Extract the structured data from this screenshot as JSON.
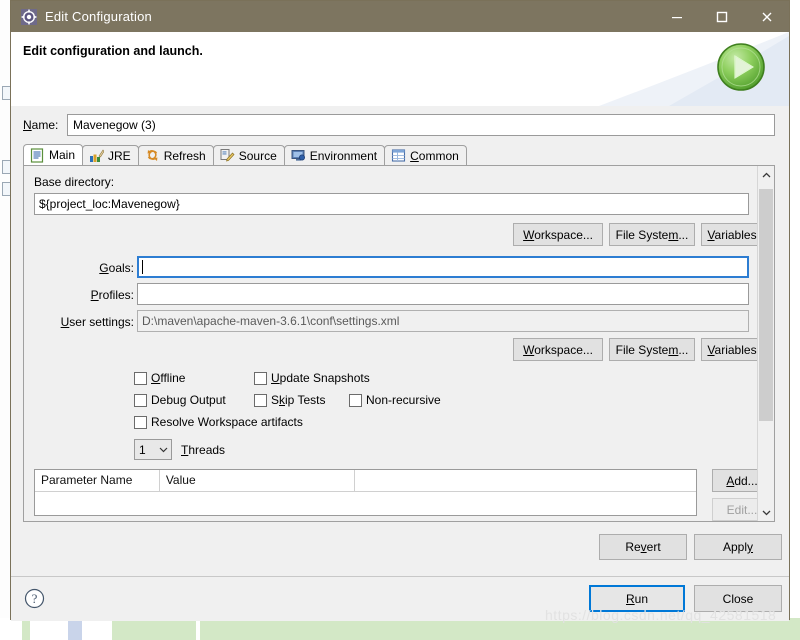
{
  "window": {
    "title": "Edit Configuration",
    "icon": "gear-icon",
    "minimize_label": "–",
    "maximize_label": "□",
    "close_label": "✕",
    "titlebar_color": "#7d7560"
  },
  "header": {
    "title": "Edit configuration and launch.",
    "run_icon": "green-run-ball-icon",
    "accent_green": "#5fb136"
  },
  "name_row": {
    "label": "Name:",
    "label_mnemonic": "N",
    "value": "Mavenegow (3)"
  },
  "tabs": [
    {
      "label": "Main",
      "mnemonic": "M",
      "icon": "main-document-icon",
      "active": true
    },
    {
      "label": "JRE",
      "mnemonic": "J",
      "icon": "jre-books-icon",
      "active": false
    },
    {
      "label": "Refresh",
      "mnemonic": "R",
      "icon": "refresh-arrows-icon",
      "active": false
    },
    {
      "label": "Source",
      "mnemonic": "S",
      "icon": "source-pencil-icon",
      "active": false
    },
    {
      "label": "Environment",
      "mnemonic": "E",
      "icon": "environment-monitor-icon",
      "active": false
    },
    {
      "label": "Common",
      "mnemonic": "C",
      "icon": "common-table-icon",
      "active": false
    }
  ],
  "main_tab": {
    "base_directory": {
      "label": "Base directory:",
      "value": "${project_loc:Mavenegow}",
      "placeholder": ""
    },
    "path_buttons_top": [
      {
        "label": "Workspace...",
        "mnemonic": "W"
      },
      {
        "label": "File System...",
        "mnemonic": "m"
      },
      {
        "label": "Variables...",
        "mnemonic": "V"
      }
    ],
    "goals": {
      "label": "Goals:",
      "mnemonic": "G",
      "value": "",
      "focused": true
    },
    "profiles": {
      "label": "Profiles:",
      "mnemonic": "P",
      "value": ""
    },
    "user_settings": {
      "label": "User settings:",
      "mnemonic": "U",
      "value": "D:\\maven\\apache-maven-3.6.1\\conf\\settings.xml",
      "readonly": true
    },
    "path_buttons_bottom": [
      {
        "label": "Workspace...",
        "mnemonic": "W"
      },
      {
        "label": "File System...",
        "mnemonic": "m"
      },
      {
        "label": "Variables...",
        "mnemonic": "V"
      }
    ],
    "checkboxes": [
      {
        "label": "Offline",
        "mnemonic": "O",
        "checked": false
      },
      {
        "label": "Update Snapshots",
        "mnemonic": "U",
        "checked": false
      },
      {
        "label": "Debug Output",
        "mnemonic": "g",
        "checked": false
      },
      {
        "label": "Skip Tests",
        "mnemonic": "k",
        "checked": false
      },
      {
        "label": "Non-recursive",
        "mnemonic": "",
        "checked": false
      },
      {
        "label": "Resolve Workspace artifacts",
        "mnemonic": "",
        "checked": false
      }
    ],
    "threads": {
      "value": "1",
      "label": "Threads",
      "mnemonic": "T",
      "options": [
        "1"
      ]
    },
    "parameter_table": {
      "columns": [
        "Parameter Name",
        "Value"
      ],
      "rows": []
    },
    "table_buttons": [
      {
        "label": "Add...",
        "mnemonic": "A"
      },
      {
        "label": "Edit...",
        "mnemonic": "E"
      }
    ],
    "scrollbar": {
      "up_arrow": "∧",
      "down_arrow": "∨"
    }
  },
  "action_buttons": {
    "revert": {
      "label": "Revert",
      "mnemonic": "v"
    },
    "apply": {
      "label": "Apply",
      "mnemonic": "y"
    }
  },
  "footer": {
    "help_icon": "question-mark-help-icon",
    "run": {
      "label": "Run",
      "mnemonic": "R",
      "default": true
    },
    "close": {
      "label": "Close",
      "mnemonic": ""
    }
  },
  "watermark": {
    "text": "https://blog.csdn.net/qq_42581518"
  }
}
